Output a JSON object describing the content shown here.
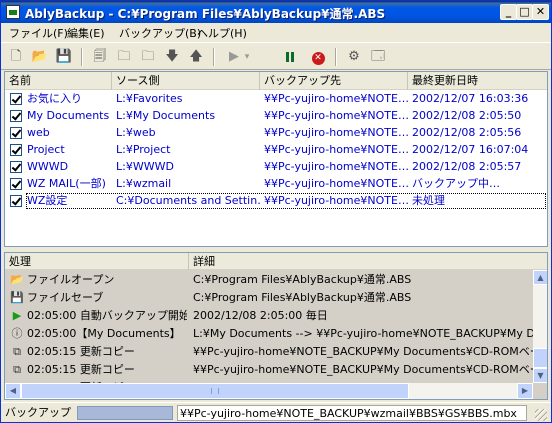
{
  "window": {
    "title": "AblyBackup - C:¥Program Files¥AblyBackup¥通常.ABS",
    "min_icon": "minimize-icon",
    "max_icon": "maximize-icon",
    "close_icon": "close-icon"
  },
  "menu": [
    "ファイル(F)",
    "編集(E)",
    "バックアップ(B)",
    "ヘルプ(H)"
  ],
  "toolbar": {
    "icons": [
      "new-file-icon",
      "open-folder-icon",
      "save-icon",
      "delete-icon",
      "folder-copy-icon",
      "folder-copy2-icon",
      "move-down-icon",
      "move-up-icon",
      "play-icon",
      "dropdown-icon",
      "pause-icon",
      "stop-icon",
      "settings-icon",
      "properties-icon"
    ],
    "stop_color": "#cc1a1a",
    "pause_color": "#0a6b2a"
  },
  "list": {
    "headers": [
      "名前",
      "ソース側",
      "バックアップ先",
      "最終更新日時"
    ],
    "rows": [
      {
        "name": "お気に入り",
        "source": "L:¥Favorites",
        "dest": "¥¥Pc-yujiro-home¥NOTE…",
        "date": "2002/12/07 16:03:36",
        "checked": true,
        "selected": false
      },
      {
        "name": "My Documents",
        "source": "L:¥My Documents",
        "dest": "¥¥Pc-yujiro-home¥NOTE…",
        "date": "2002/12/08 2:05:50",
        "checked": true,
        "selected": false
      },
      {
        "name": "web",
        "source": "L:¥web",
        "dest": "¥¥Pc-yujiro-home¥NOTE…",
        "date": "2002/12/08 2:05:56",
        "checked": true,
        "selected": false
      },
      {
        "name": "Project",
        "source": "L:¥Project",
        "dest": "¥¥Pc-yujiro-home¥NOTE…",
        "date": "2002/12/07 16:07:04",
        "checked": true,
        "selected": false
      },
      {
        "name": "WWWD",
        "source": "L:¥WWWD",
        "dest": "¥¥Pc-yujiro-home¥NOTE…",
        "date": "2002/12/08 2:05:57",
        "checked": true,
        "selected": false
      },
      {
        "name": "WZ MAIL(一部)",
        "source": "L:¥wzmail",
        "dest": "¥¥Pc-yujiro-home¥NOTE…",
        "date": "バックアップ中…",
        "checked": true,
        "selected": false
      },
      {
        "name": "WZ設定",
        "source": "C:¥Documents and Settin…",
        "dest": "¥¥Pc-yujiro-home¥NOTE…",
        "date": "未処理",
        "checked": true,
        "selected": true
      }
    ]
  },
  "log": {
    "headers": [
      "処理",
      "詳細"
    ],
    "rows": [
      {
        "icon": "open-folder-icon",
        "glyph": "📂",
        "action": "ファイルオープン",
        "detail": "C:¥Program Files¥AblyBackup¥通常.ABS"
      },
      {
        "icon": "save-icon",
        "glyph": "💾",
        "action": "ファイルセーブ",
        "detail": "C:¥Program Files¥AblyBackup¥通常.ABS"
      },
      {
        "icon": "play-icon",
        "glyph": "▶",
        "action": "02:05:00 自動バックアップ開始",
        "detail": "2002/12/08 2:05:00 毎日"
      },
      {
        "icon": "info-icon",
        "glyph": "ⓘ",
        "action": "02:05:00【My Documents】",
        "detail": "L:¥My Documents --> ¥¥Pc-yujiro-home¥NOTE_BACKUP¥My Do"
      },
      {
        "icon": "copy-icon",
        "glyph": "⧉",
        "action": "02:05:15 更新コピー",
        "detail": "¥¥Pc-yujiro-home¥NOTE_BACKUP¥My Documents¥CD-ROMベー…"
      },
      {
        "icon": "copy-icon",
        "glyph": "⧉",
        "action": "02:05:15 更新コピー",
        "detail": "¥¥Pc-yujiro-home¥NOTE_BACKUP¥My Documents¥CD-ROMベー…"
      },
      {
        "icon": "copy-icon",
        "glyph": "⧉",
        "action": "02:05:35 更新コピー",
        "detail": "¥¥Pc-yujiro-home¥NOTE_BACKUP¥My Documents¥Pocket My Do"
      }
    ]
  },
  "status": {
    "label": "バックアップ",
    "path": "¥¥Pc-yujiro-home¥NOTE_BACKUP¥wzmail¥BBS¥GS¥BBS.mbx"
  }
}
